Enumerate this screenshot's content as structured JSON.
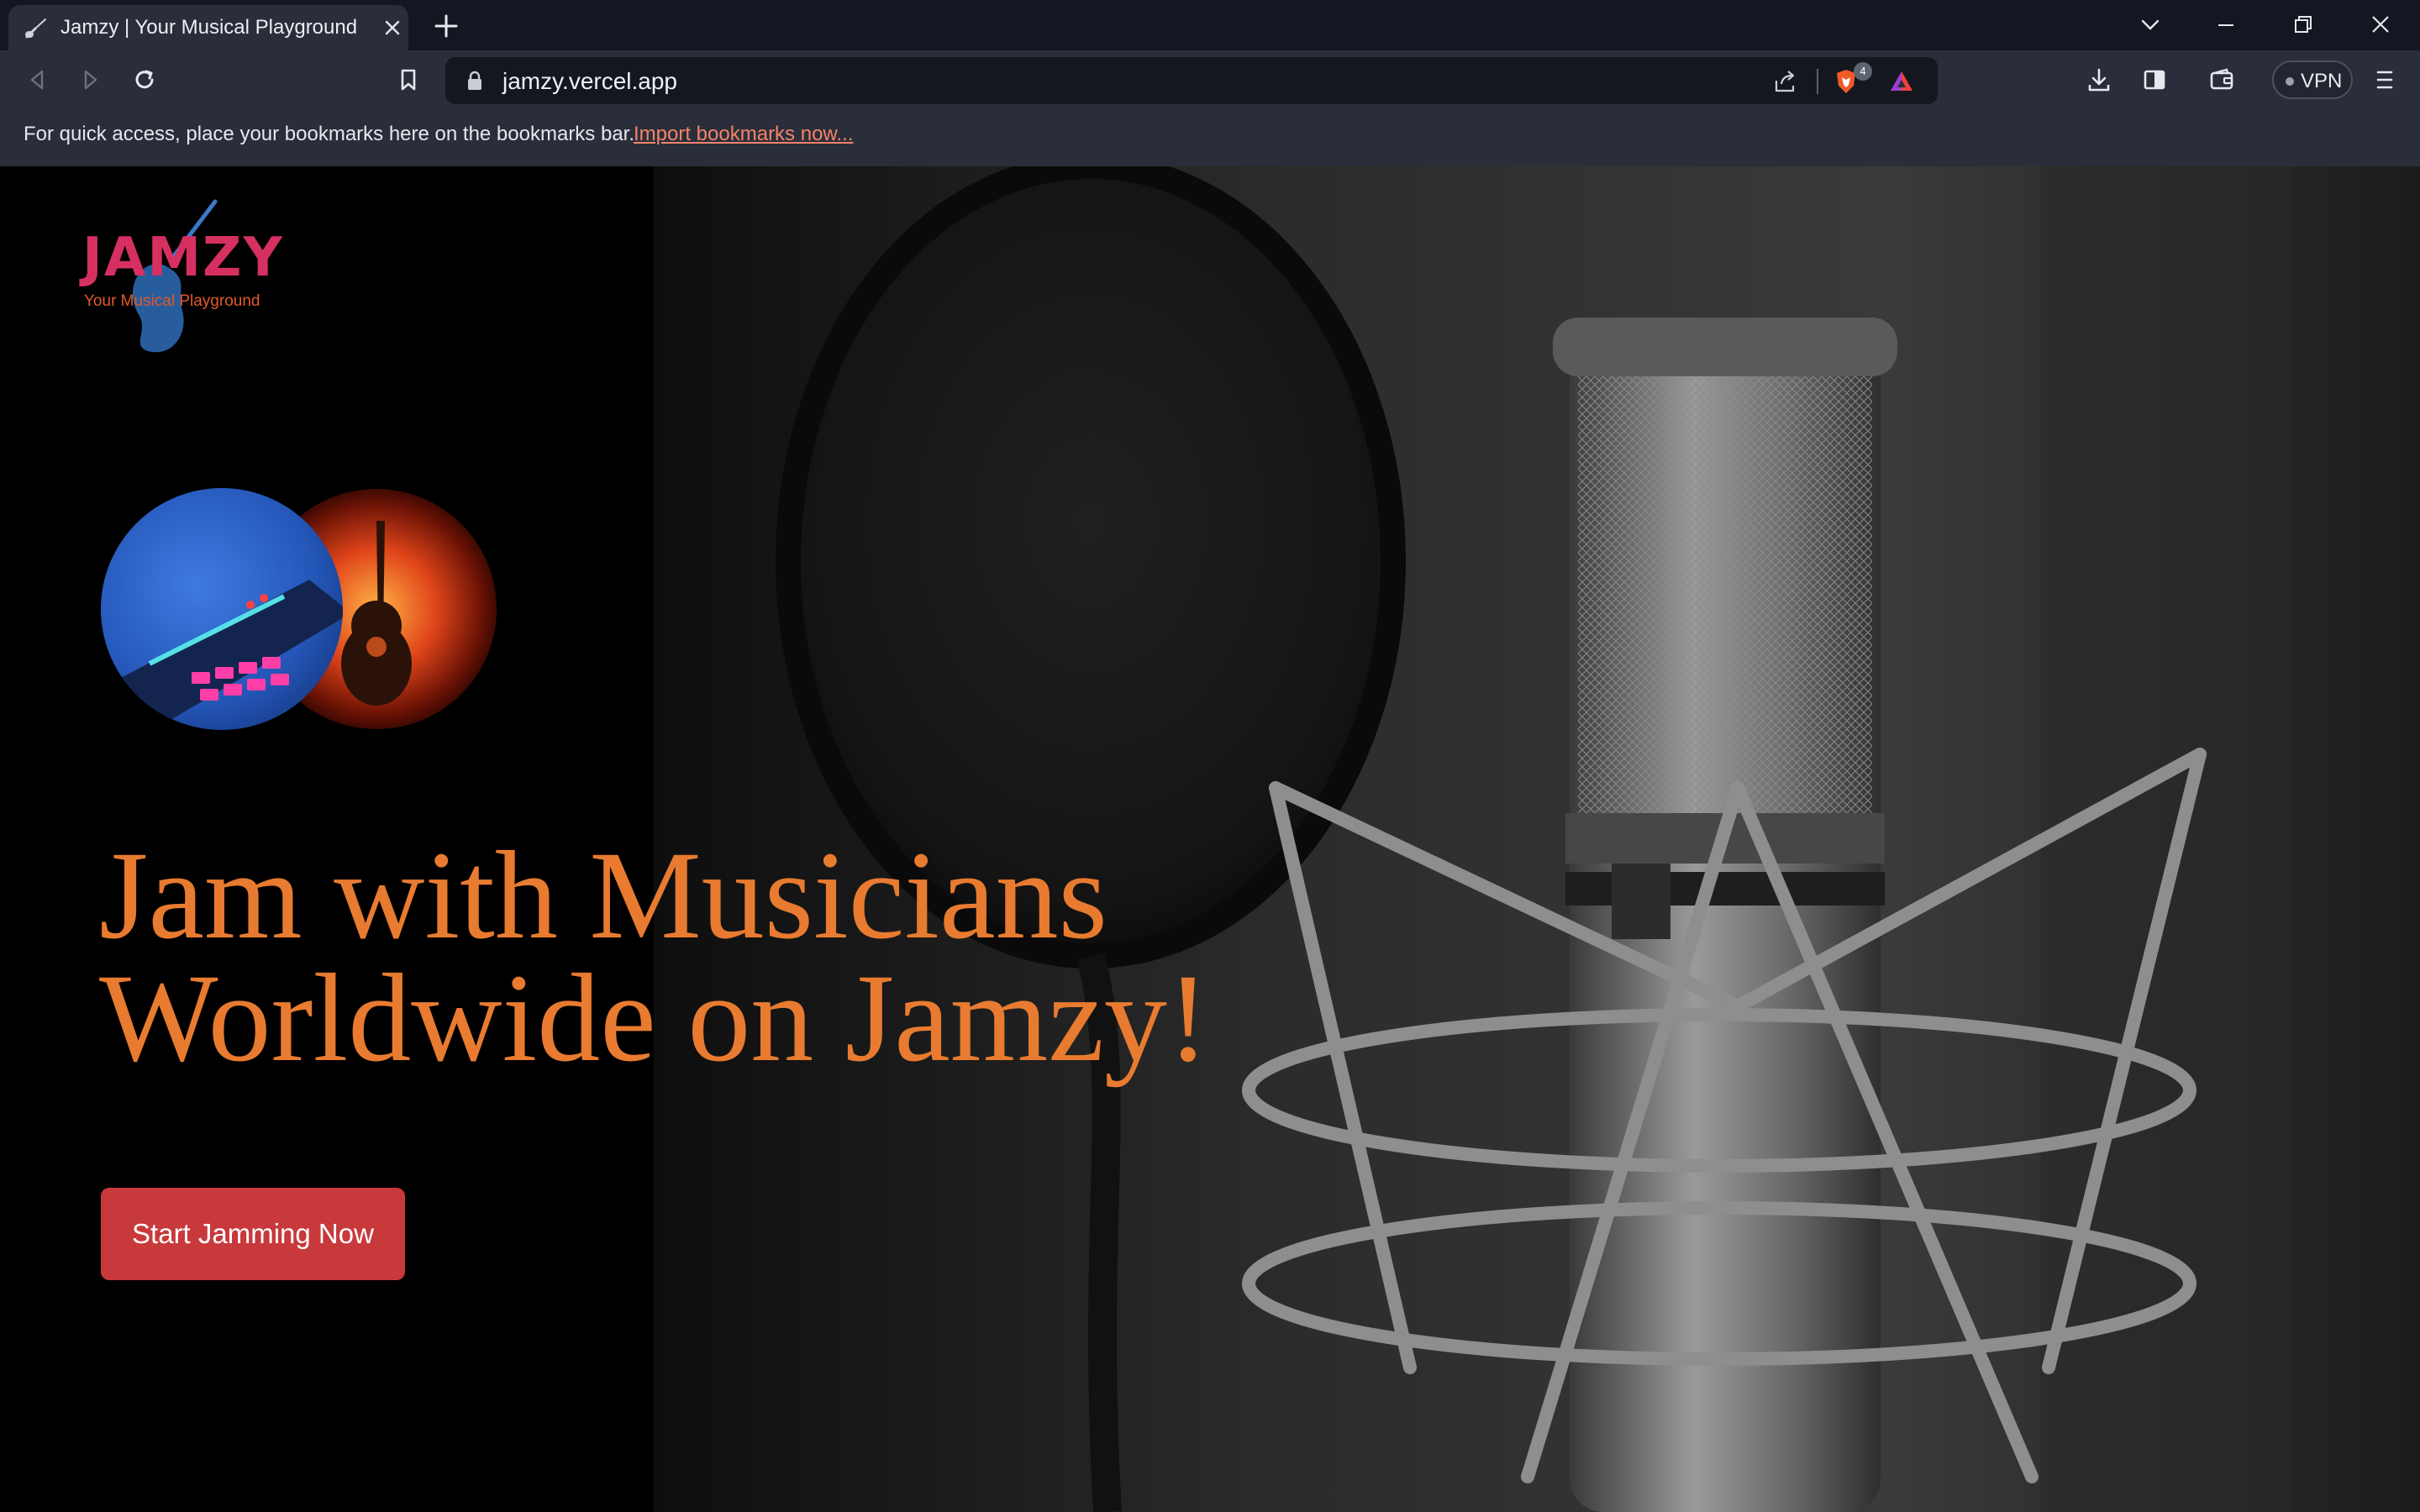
{
  "browser": {
    "tab": {
      "title": "Jamzy | Your Musical Playground"
    },
    "address_bar": {
      "url": "jamzy.vercel.app"
    },
    "brave_shields_count": "4",
    "vpn_label": "VPN",
    "bookmarks_bar": {
      "message": "For quick access, place your bookmarks here on the bookmarks bar.",
      "import_link": "Import bookmarks now..."
    },
    "colors": {
      "titlebar": "#141721",
      "toolbar": "#2a2e3a",
      "omnibox": "#15171f",
      "link": "#f4836a"
    }
  },
  "page": {
    "logo": {
      "wordmark": "JAMZY",
      "tagline": "Your Musical Playground"
    },
    "headline_lines": [
      "Jam with Musicians",
      "Worldwide on Jamzy!"
    ],
    "cta_label": "Start Jamming Now",
    "colors": {
      "headline": "#e87b30",
      "cta_bg": "#c8393b",
      "logo_word": "#d63061",
      "logo_tag": "#e0592a",
      "background": "#000000"
    },
    "hero_image": "studio-microphone-photo",
    "feature_images": [
      "synth-pads-image",
      "flaming-guitar-image"
    ]
  }
}
